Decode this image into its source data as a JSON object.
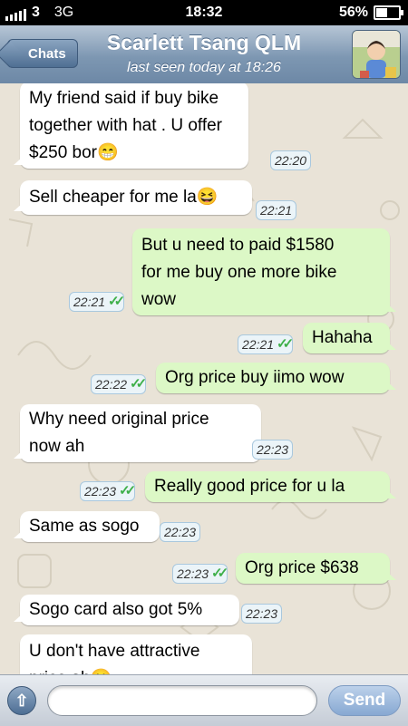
{
  "status": {
    "carrier": "3",
    "network": "3G",
    "time": "18:32",
    "battery": "56%",
    "battery_level": 0.56
  },
  "nav": {
    "back_label": "Chats",
    "contact_name": "Scarlett Tsang QLM",
    "last_seen": "last seen today at 18:26"
  },
  "messages": [
    {
      "direction": "in",
      "text": "My friend said if buy bike\ntogether with hat . U offer\n$250 bor😁",
      "time": "22:20"
    },
    {
      "direction": "in",
      "text": "Sell cheaper for me la😆",
      "time": "22:21"
    },
    {
      "direction": "out",
      "text": "But u need to paid $1580\nfor me buy one more bike\nwow",
      "time": "22:21"
    },
    {
      "direction": "out",
      "text": "Hahaha",
      "time": "22:21"
    },
    {
      "direction": "out",
      "text": "Org price buy iimo wow",
      "time": "22:22"
    },
    {
      "direction": "in",
      "text": "Why need original price\nnow ah",
      "time": "22:23"
    },
    {
      "direction": "out",
      "text": "Really good price for u la",
      "time": "22:23"
    },
    {
      "direction": "in",
      "text": "Same as sogo",
      "time": "22:23"
    },
    {
      "direction": "out",
      "text": "Org price $638",
      "time": "22:23"
    },
    {
      "direction": "in",
      "text": "Sogo card also got 5%",
      "time": "22:23"
    },
    {
      "direction": "in",
      "text": "U don't have attractive\nprice ah😀",
      "time": ""
    }
  ],
  "input": {
    "placeholder": "",
    "send_label": "Send"
  },
  "colors": {
    "incoming_bubble": "#ffffff",
    "outgoing_bubble": "#dcf8c6",
    "tick": "#3fb04a"
  }
}
